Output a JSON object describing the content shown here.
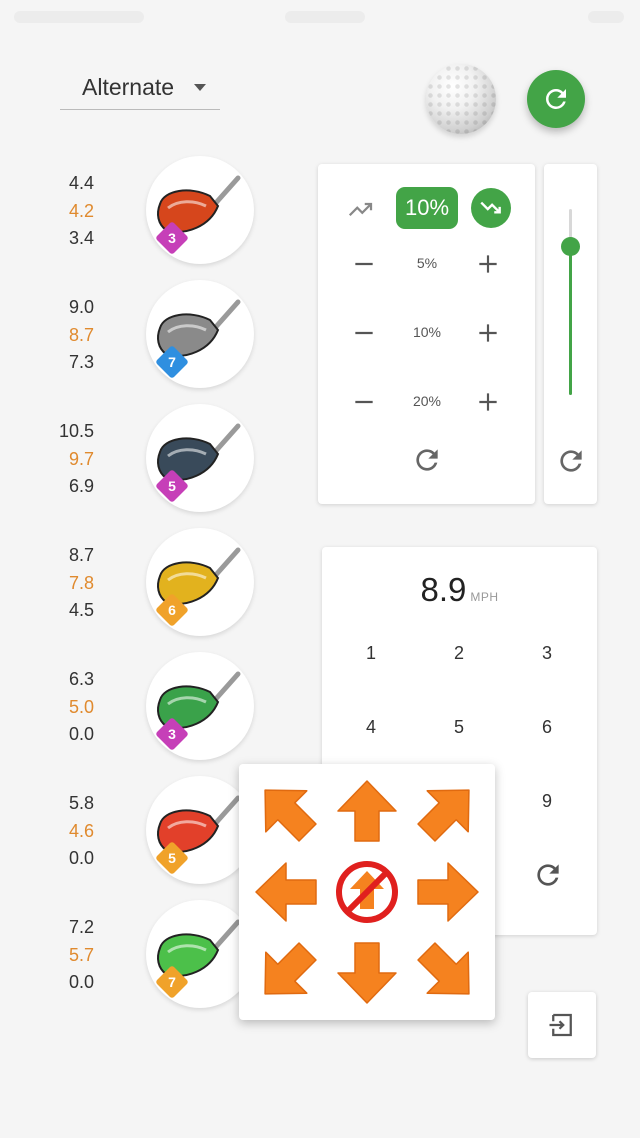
{
  "header": {
    "dropdown_label": "Alternate"
  },
  "speed_panel": {
    "trend_up_icon": "trending-up-icon",
    "selected_percent": "10%",
    "trend_down_icon": "trending-down-icon",
    "steps": [
      "5%",
      "10%",
      "20%"
    ],
    "slider_level_percent": 80
  },
  "clubs": [
    {
      "stats": [
        "4.4",
        "4.2",
        "3.4"
      ],
      "badge": "3",
      "badge_color": "#c63fb8",
      "head_color": "#d6461c"
    },
    {
      "stats": [
        "9.0",
        "8.7",
        "7.3"
      ],
      "badge": "7",
      "badge_color": "#2f8fe0",
      "head_color": "#8a8a8a"
    },
    {
      "stats": [
        "10.5",
        "9.7",
        "6.9"
      ],
      "badge": "5",
      "badge_color": "#c63fb8",
      "head_color": "#394a5a"
    },
    {
      "stats": [
        "8.7",
        "7.8",
        "4.5"
      ],
      "badge": "6",
      "badge_color": "#f0a22a",
      "head_color": "#e2b21e"
    },
    {
      "stats": [
        "6.3",
        "5.0",
        "0.0"
      ],
      "badge": "3",
      "badge_color": "#c63fb8",
      "head_color": "#3aa24a"
    },
    {
      "stats": [
        "5.8",
        "4.6",
        "0.0"
      ],
      "badge": "5",
      "badge_color": "#f0a22a",
      "head_color": "#e2402a"
    },
    {
      "stats": [
        "7.2",
        "5.7",
        "0.0"
      ],
      "badge": "7",
      "badge_color": "#f0a22a",
      "head_color": "#4cc04a"
    }
  ],
  "keypad": {
    "speed_value": "8.9",
    "speed_unit": "MPH",
    "keys": [
      "1",
      "2",
      "3",
      "4",
      "5",
      "6",
      "9"
    ]
  },
  "colors": {
    "accent_green": "#43a447",
    "stat_orange": "#e08a2e",
    "arrow_orange": "#f5821f",
    "no_sign_red": "#e0201e"
  }
}
